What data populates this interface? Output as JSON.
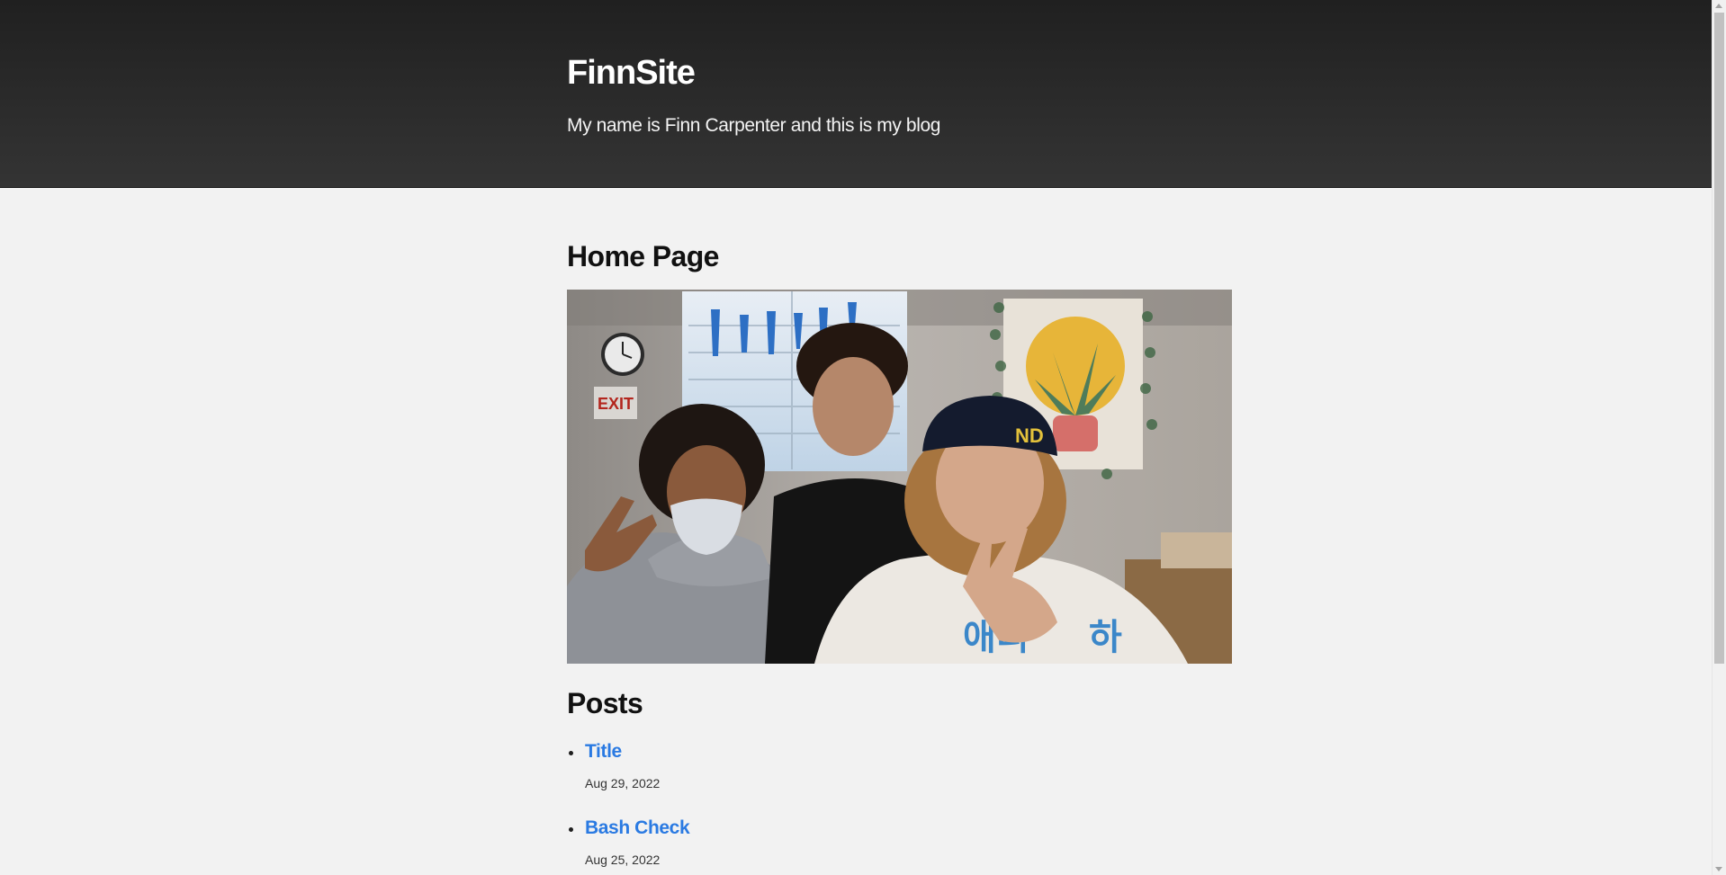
{
  "header": {
    "site_title": "FinnSite",
    "site_description": "My name is Finn Carpenter and this is my blog"
  },
  "main": {
    "page_title": "Home Page",
    "photo_alt": "group photo",
    "posts_heading": "Posts",
    "posts": [
      {
        "title": "Title",
        "date": "Aug 29, 2022"
      },
      {
        "title": "Bash Check",
        "date": "Aug 25, 2022"
      }
    ]
  },
  "colors": {
    "header_top": "#202020",
    "header_bottom": "#343434",
    "body_bg": "#f2f2f2",
    "link": "#2a7ae2",
    "text": "#111111"
  }
}
